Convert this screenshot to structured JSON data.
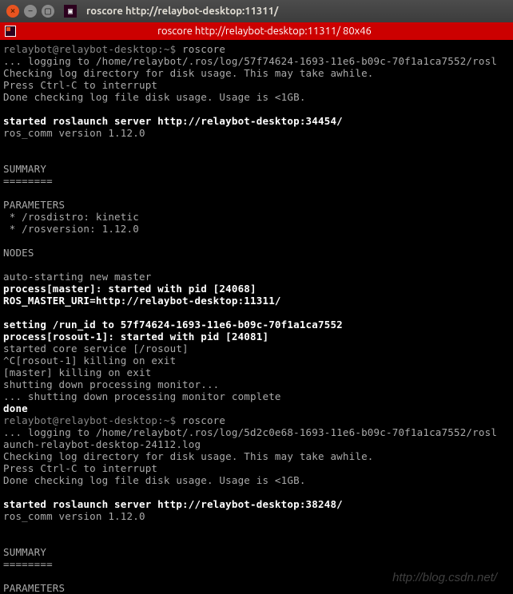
{
  "window": {
    "title": "roscore http://relaybot-desktop:11311/"
  },
  "tab": {
    "title": "roscore http://relaybot-desktop:11311/ 80x46"
  },
  "terminal": {
    "prompt1": "relaybot@relaybot-desktop:~$ ",
    "cmd1": "roscore",
    "l1": "... logging to /home/relaybot/.ros/log/57f74624-1693-11e6-b09c-70f1a1ca7552/rosl",
    "l2": "Checking log directory for disk usage. This may take awhile.",
    "l3": "Press Ctrl-C to interrupt",
    "l4": "Done checking log file disk usage. Usage is <1GB.",
    "l5": "started roslaunch server http://relaybot-desktop:34454/",
    "l6": "ros_comm version 1.12.0",
    "l7": "SUMMARY",
    "l8": "========",
    "l9": "PARAMETERS",
    "l10": " * /rosdistro: kinetic",
    "l11": " * /rosversion: 1.12.0",
    "l12": "NODES",
    "l13": "auto-starting new master",
    "l14": "process[master]: started with pid [24068]",
    "l15": "ROS_MASTER_URI=http://relaybot-desktop:11311/",
    "l16": "setting /run_id to 57f74624-1693-11e6-b09c-70f1a1ca7552",
    "l17": "process[rosout-1]: started with pid [24081]",
    "l18": "started core service [/rosout]",
    "l19": "^C[rosout-1] killing on exit",
    "l20": "[master] killing on exit",
    "l21": "shutting down processing monitor...",
    "l22": "... shutting down processing monitor complete",
    "l23": "done",
    "prompt2": "relaybot@relaybot-desktop:~$ ",
    "cmd2": "roscore",
    "l24": "... logging to /home/relaybot/.ros/log/5d2c0e68-1693-11e6-b09c-70f1a1ca7552/rosl",
    "l25": "aunch-relaybot-desktop-24112.log",
    "l26": "Checking log directory for disk usage. This may take awhile.",
    "l27": "Press Ctrl-C to interrupt",
    "l28": "Done checking log file disk usage. Usage is <1GB.",
    "l29": "started roslaunch server http://relaybot-desktop:38248/",
    "l30": "ros_comm version 1.12.0",
    "l31": "SUMMARY",
    "l32": "========",
    "l33": "PARAMETERS"
  },
  "watermark": "http://blog.csdn.net/"
}
